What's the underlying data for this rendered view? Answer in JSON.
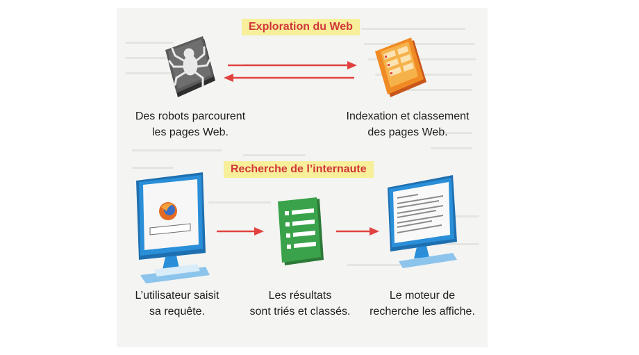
{
  "section1": {
    "title": "Exploration du Web",
    "left_caption": "Des robots parcourent\nles pages Web.",
    "right_caption": "Indexation et classement\ndes pages Web."
  },
  "section2": {
    "title": "Recherche de l’internaute",
    "step1_caption": "L’utilisateur saisit\nsa requête.",
    "step2_caption": "Les résultats\nsont triés et classés.",
    "step3_caption": "Le moteur de\nrecherche les affiche."
  },
  "colors": {
    "banner_bg": "#f7ef9a",
    "banner_text": "#d2353a",
    "arrow": "#e2423f",
    "monitor": "#2a8fd8",
    "results_green": "#3aa24a",
    "robot_grey": "#4a4a4a",
    "index_orange": "#f08a24"
  },
  "icons": [
    "spider-robot-icon",
    "index-document-icon",
    "browser-monitor-icon",
    "results-list-icon",
    "results-monitor-icon"
  ]
}
